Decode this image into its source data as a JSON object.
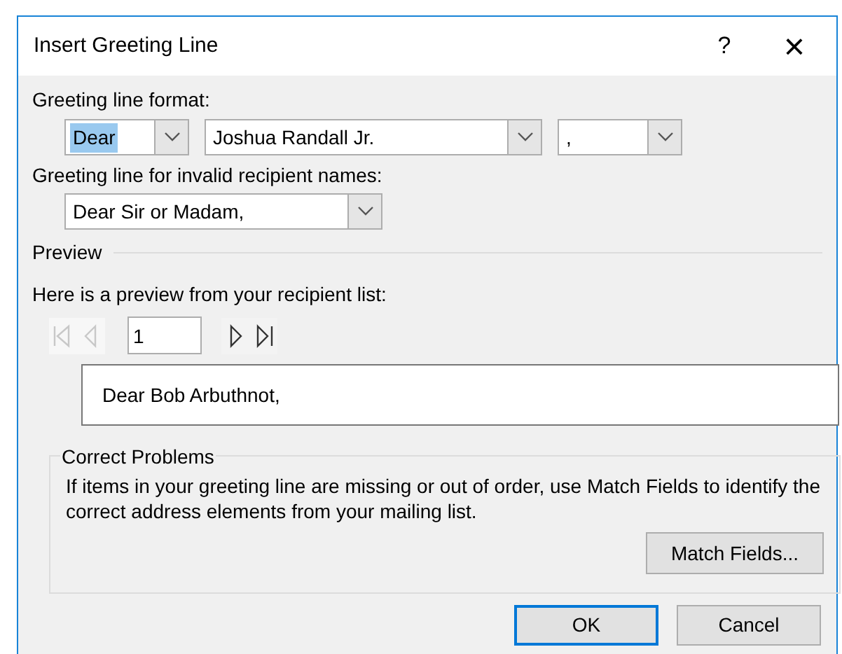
{
  "window": {
    "title": "Insert Greeting Line",
    "help": "?",
    "close": "×"
  },
  "format": {
    "label": "Greeting line format:",
    "combos": [
      {
        "value": "Dear",
        "focused": true
      },
      {
        "value": "Joshua Randall Jr.",
        "focused": false
      },
      {
        "value": ",",
        "focused": false
      }
    ]
  },
  "invalid": {
    "label": "Greeting line for invalid recipient names:",
    "combo": {
      "value": "Dear Sir or Madam,",
      "focused": false
    }
  },
  "preview": {
    "heading": "Preview",
    "label": "Here is a preview from your recipient list:",
    "record": "1",
    "nav": [
      {
        "kind": "first",
        "disabled": true
      },
      {
        "kind": "prev",
        "disabled": true
      },
      {
        "kind": "next",
        "disabled": false
      },
      {
        "kind": "last",
        "disabled": false
      }
    ],
    "text": "Dear Bob Arbuthnot,"
  },
  "problems": {
    "heading": "Correct Problems",
    "text": "If items in your greeting line are missing or out of order, use Match Fields to identify the correct address elements from your mailing list.",
    "button": "Match Fields..."
  },
  "buttons": [
    {
      "label": "OK",
      "default": true
    },
    {
      "label": "Cancel",
      "default": false
    }
  ]
}
